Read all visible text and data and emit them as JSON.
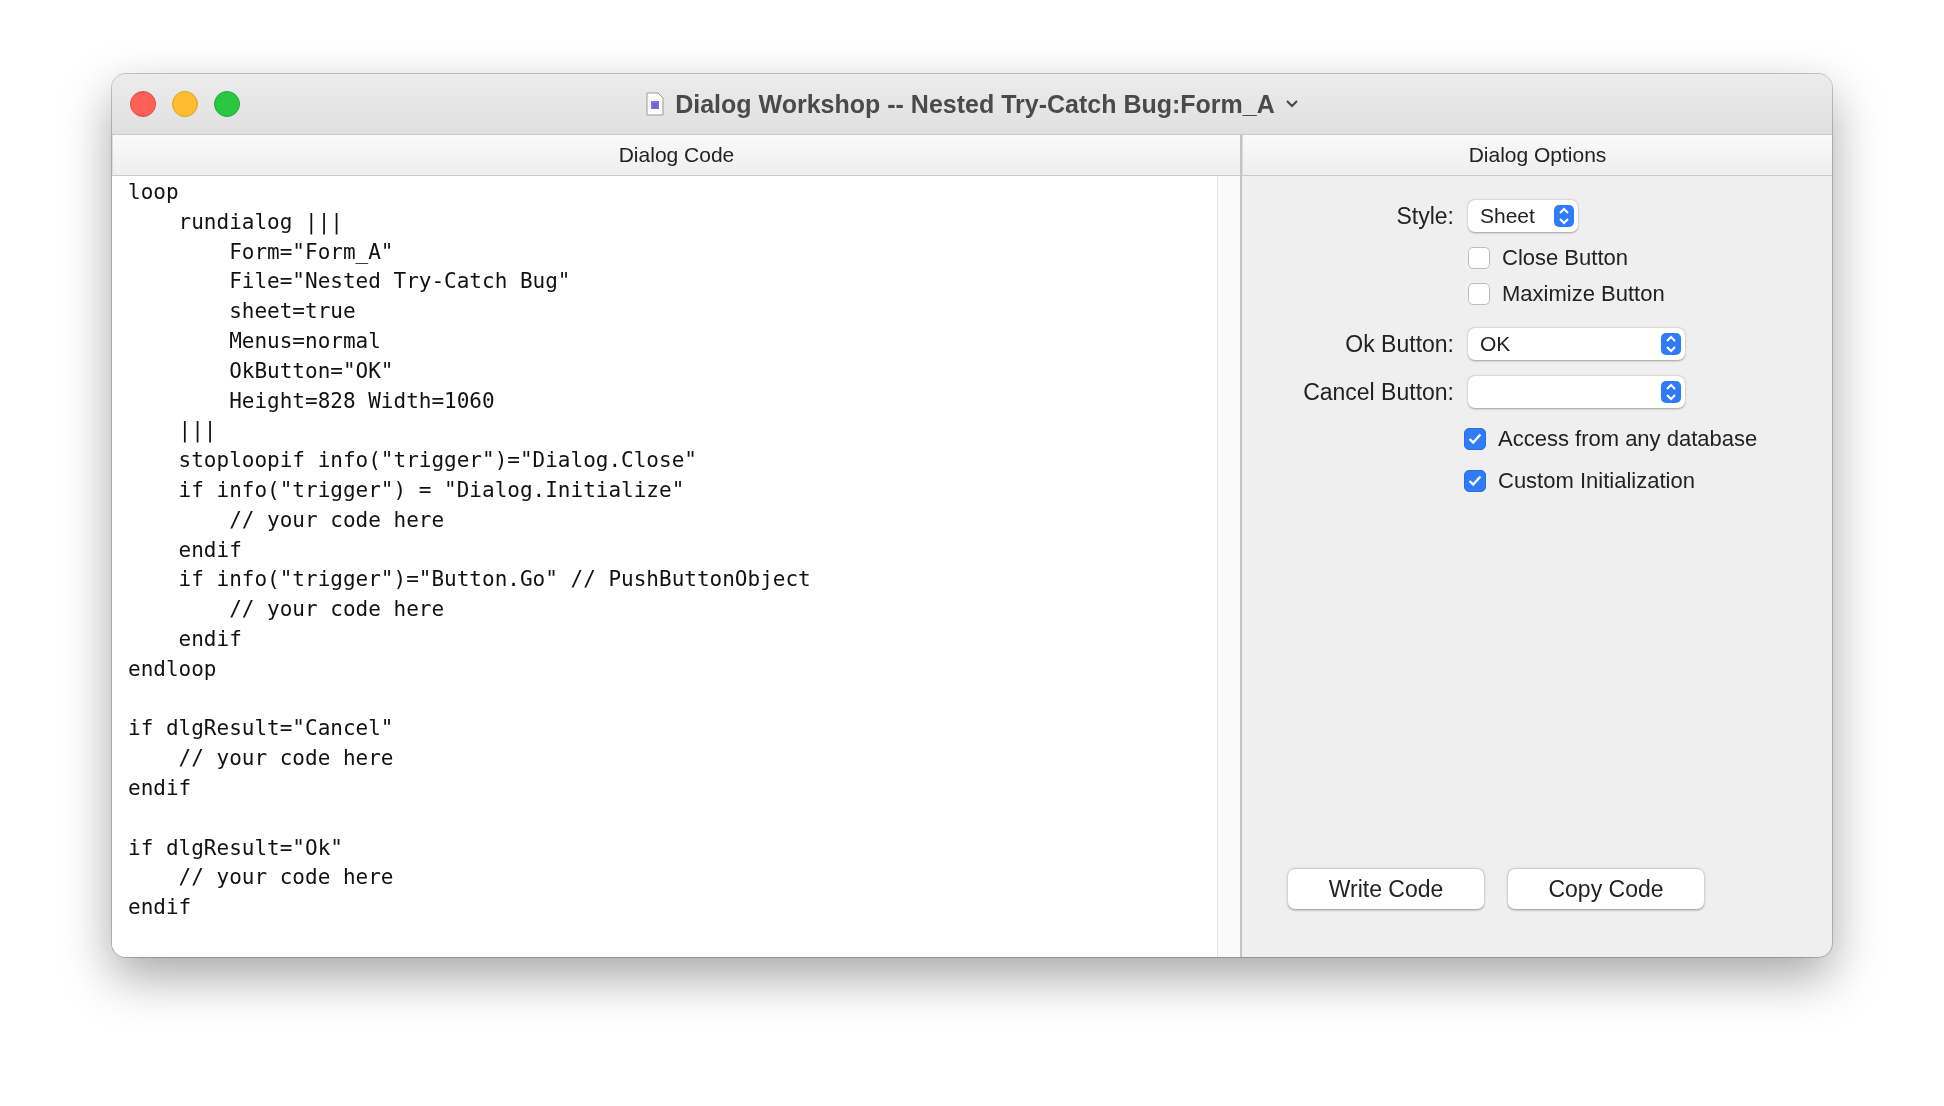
{
  "window": {
    "title": "Dialog Workshop -- Nested Try-Catch Bug:Form_A"
  },
  "code_pane": {
    "header": "Dialog Code",
    "code": "loop\n    rundialog |||\n        Form=\"Form_A\"\n        File=\"Nested Try-Catch Bug\"\n        sheet=true\n        Menus=normal\n        OkButton=\"OK\"\n        Height=828 Width=1060\n    |||\n    stoploopif info(\"trigger\")=\"Dialog.Close\"\n    if info(\"trigger\") = \"Dialog.Initialize\"\n        // your code here\n    endif\n    if info(\"trigger\")=\"Button.Go\" // PushButtonObject\n        // your code here\n    endif\nendloop\n\nif dlgResult=\"Cancel\"\n    // your code here\nendif\n\nif dlgResult=\"Ok\"\n    // your code here\nendif"
  },
  "options_pane": {
    "header": "Dialog Options",
    "style": {
      "label": "Style:",
      "value": "Sheet"
    },
    "window_checkboxes": [
      {
        "label": "Close Button",
        "checked": false
      },
      {
        "label": "Maximize Button",
        "checked": false
      }
    ],
    "ok_button": {
      "label": "Ok Button:",
      "value": "OK"
    },
    "cancel_button": {
      "label": "Cancel Button:"
    },
    "checkboxes": [
      {
        "label": "Access from any database",
        "checked": true
      },
      {
        "label": "Custom Initialization",
        "checked": true
      }
    ],
    "buttons": [
      "Write Code",
      "Copy Code"
    ]
  }
}
